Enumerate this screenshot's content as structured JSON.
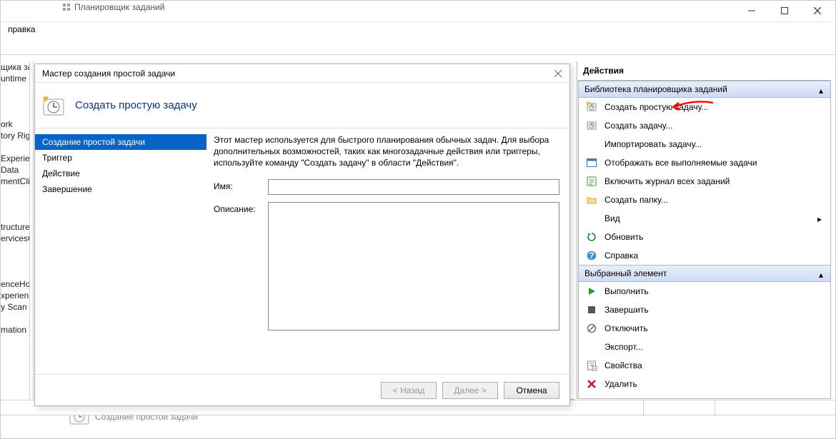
{
  "titlebar": {
    "tab_icon": "tree-icon",
    "tab_label": "Планировщик заданий"
  },
  "menubar": {
    "help": "правка"
  },
  "left_tree": {
    "items": [
      "щика за",
      "untime",
      "",
      "",
      "",
      "ork",
      "tory Righ",
      "",
      "Experien",
      "Data",
      "mentCli",
      "",
      "",
      "",
      "tructure",
      "ervicesCl",
      "",
      "",
      "",
      "enceHos",
      "xperienc",
      "y Scan",
      "",
      "mation"
    ]
  },
  "actions": {
    "pane_title": "Действия",
    "section1_title": "Библиотека планировщика заданий",
    "section1_items": [
      {
        "icon": "new-basic",
        "label": "Создать простую задачу..."
      },
      {
        "icon": "new-task",
        "label": "Создать задачу..."
      },
      {
        "icon": "",
        "label": "Импортировать задачу..."
      },
      {
        "icon": "visible",
        "label": "Отображать все выполняемые задачи"
      },
      {
        "icon": "log",
        "label": "Включить журнал всех заданий"
      },
      {
        "icon": "folder",
        "label": "Создать папку..."
      },
      {
        "icon": "",
        "label": "Вид",
        "sub": true
      },
      {
        "icon": "refresh",
        "label": "Обновить"
      },
      {
        "icon": "help",
        "label": "Справка"
      }
    ],
    "section2_title": "Выбранный элемент",
    "section2_items": [
      {
        "icon": "run",
        "label": "Выполнить"
      },
      {
        "icon": "stop",
        "label": "Завершить"
      },
      {
        "icon": "disable",
        "label": "Отключить"
      },
      {
        "icon": "",
        "label": "Экспорт..."
      },
      {
        "icon": "props",
        "label": "Свойства"
      },
      {
        "icon": "delete",
        "label": "Удалить"
      }
    ]
  },
  "wizard": {
    "title": "Мастер создания простой задачи",
    "header": "Создать простую задачу",
    "steps": [
      "Создание простой задачи",
      "Триггер",
      "Действие",
      "Завершение"
    ],
    "intro": "Этот мастер используется для быстрого планирования обычных задач.  Для выбора дополнительных возможностей, таких как многозадачные действия или триггеры, используйте команду \"Создать задачу\" в области \"Действия\".",
    "name_label": "Имя:",
    "name_value": "",
    "desc_label": "Описание:",
    "desc_value": "",
    "btn_back": "< Назад",
    "btn_next": "Далее >",
    "btn_cancel": "Отмена"
  },
  "bottom_status": "Создание простой задачи"
}
